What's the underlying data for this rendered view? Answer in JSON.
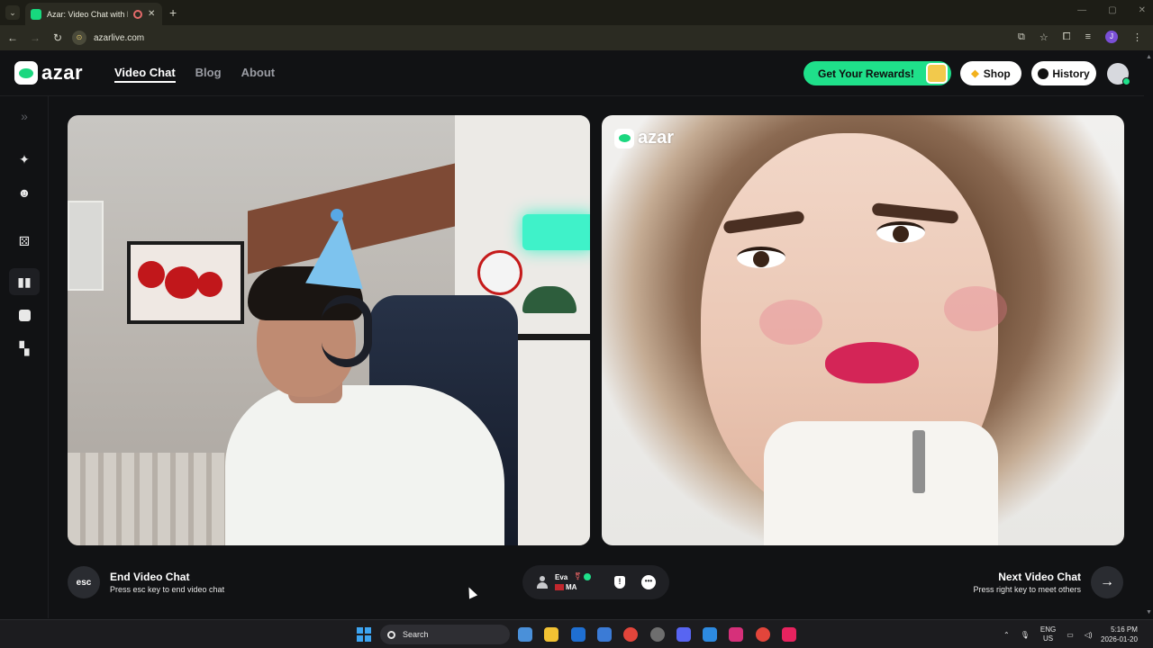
{
  "browser": {
    "tab_title": "Azar: Video Chat with New",
    "url": "azarlive.com",
    "profile_initial": "J"
  },
  "site": {
    "logo_text": "azar",
    "nav": [
      "Video Chat",
      "Blog",
      "About"
    ],
    "rewards_label": "Get Your Rewards!",
    "shop_label": "Shop",
    "history_label": "History"
  },
  "video": {
    "right_overlay_logo": "azar"
  },
  "controls": {
    "esc_label": "esc",
    "end_title": "End Video Chat",
    "end_sub": "Press esc key to end video chat",
    "partner_name": "Eva",
    "partner_country": "MA",
    "next_title": "Next Video Chat",
    "next_sub": "Press right key to meet others"
  },
  "taskbar": {
    "search_label": "Search",
    "lang_top": "ENG",
    "lang_bottom": "US",
    "time": "5:16 PM",
    "date": "2026-01-20"
  },
  "colors": {
    "brand_green": "#1fe08a",
    "page_bg": "#111214"
  }
}
